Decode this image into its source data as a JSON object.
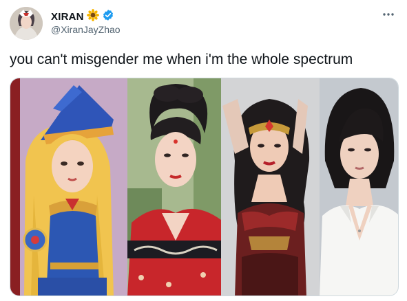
{
  "author": {
    "display_name": "XIRAN",
    "handle": "@XiranJayZhao",
    "name_emoji_icon": "sunflower-icon",
    "verified_icon": "verified-badge-icon"
  },
  "tweet": {
    "text": "you can't misgender me when i'm the whole spectrum"
  },
  "menu": {
    "icon": "more-options-icon"
  },
  "media": {
    "panels": [
      "dark-magician-girl-cosplay",
      "red-hanfu-cosplay",
      "wonder-woman-cosplay",
      "white-shirt-portrait"
    ]
  },
  "colors": {
    "verified": "#1d9bf0",
    "secondary_text": "#536471",
    "primary_text": "#0f1419",
    "border": "#cfd9de"
  }
}
